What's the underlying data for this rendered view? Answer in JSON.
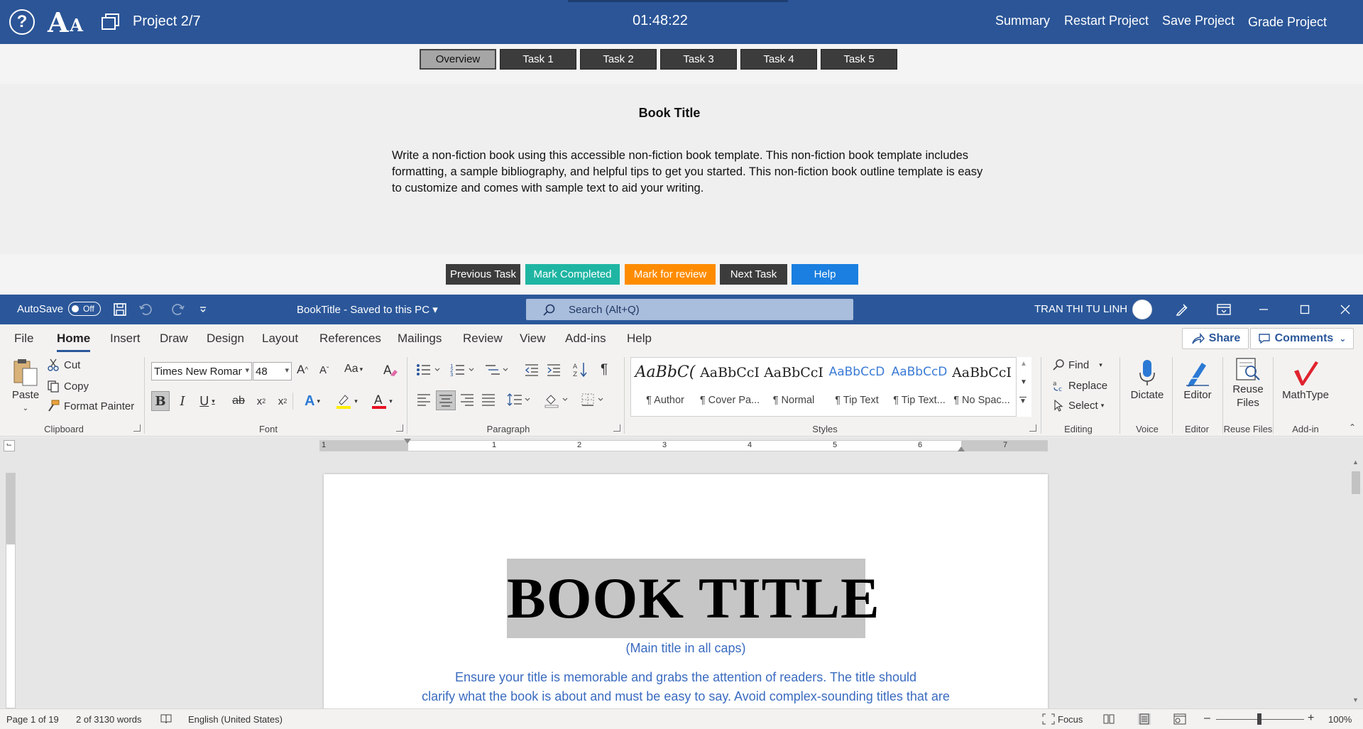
{
  "exam_bar": {
    "project_label": "Project 2/7",
    "timer": "01:48:22",
    "links": [
      "Summary",
      "Restart Project",
      "Save Project",
      "Grade Project"
    ]
  },
  "task_tabs": [
    "Overview",
    "Task 1",
    "Task 2",
    "Task 3",
    "Task 4",
    "Task 5"
  ],
  "task": {
    "title": "Book Title",
    "description": "Write a non-fiction book using this accessible non-fiction book template. This non-fiction book template includes formatting, a sample bibliography, and helpful tips to get you started. This non-fiction book outline template is easy to customize and comes with sample text to aid your writing."
  },
  "actions": {
    "previous": "Previous Task",
    "mark_completed": "Mark Completed",
    "mark_review": "Mark for review",
    "next": "Next Task",
    "help": "Help",
    "colors": {
      "dark": "#3c3c3c",
      "teal": "#1fb5a3",
      "orange": "#ff8c00",
      "blue": "#1a7fe0"
    }
  },
  "word": {
    "autosave_label": "AutoSave",
    "autosave_state": "Off",
    "doc_name": "BookTitle  -  Saved to this PC",
    "search_placeholder": "Search (Alt+Q)",
    "user_name": "TRAN THI TU LINH"
  },
  "ribbon_tabs": [
    "File",
    "Home",
    "Insert",
    "Draw",
    "Design",
    "Layout",
    "References",
    "Mailings",
    "Review",
    "View",
    "Add-ins",
    "Help"
  ],
  "ribbon_right": {
    "share": "Share",
    "comments": "Comments"
  },
  "clipboard": {
    "paste": "Paste",
    "cut": "Cut",
    "copy": "Copy",
    "format_painter": "Format Painter",
    "label": "Clipboard"
  },
  "font": {
    "name": "Times New Roman",
    "size": "48",
    "label": "Font"
  },
  "paragraph": {
    "label": "Paragraph"
  },
  "styles": {
    "label": "Styles",
    "items": [
      {
        "sample": "AaBbC(",
        "name": "¶ Author"
      },
      {
        "sample": "AaBbCcI",
        "name": "¶ Cover Pa..."
      },
      {
        "sample": "AaBbCcI",
        "name": "¶ Normal"
      },
      {
        "sample": "AaBbCcD",
        "name": "¶ Tip Text"
      },
      {
        "sample": "AaBbCcD",
        "name": "¶ Tip Text..."
      },
      {
        "sample": "AaBbCcI",
        "name": "¶ No Spac..."
      }
    ]
  },
  "editing": {
    "find": "Find",
    "replace": "Replace",
    "select": "Select",
    "label": "Editing"
  },
  "voice": {
    "dictate": "Dictate",
    "label": "Voice"
  },
  "editor": {
    "editor": "Editor",
    "label": "Editor"
  },
  "reuse": {
    "line1": "Reuse",
    "line2": "Files",
    "label": "Reuse Files"
  },
  "addin": {
    "mathtype": "MathType",
    "label": "Add-in"
  },
  "ruler_numbers": [
    "1",
    "1",
    "2",
    "3",
    "4",
    "5",
    "6",
    "7"
  ],
  "document": {
    "title": "BOOK TITLE",
    "subtitle": "(Main title in all caps)",
    "body_line1": "Ensure your title is memorable and grabs the attention of readers. The title should",
    "body_line2": "clarify what the book is about and must be easy to say. Avoid complex-sounding titles that are"
  },
  "status": {
    "page": "Page 1 of 19",
    "words": "2 of 3130 words",
    "language": "English (United States)",
    "focus": "Focus",
    "zoom": "100%"
  }
}
